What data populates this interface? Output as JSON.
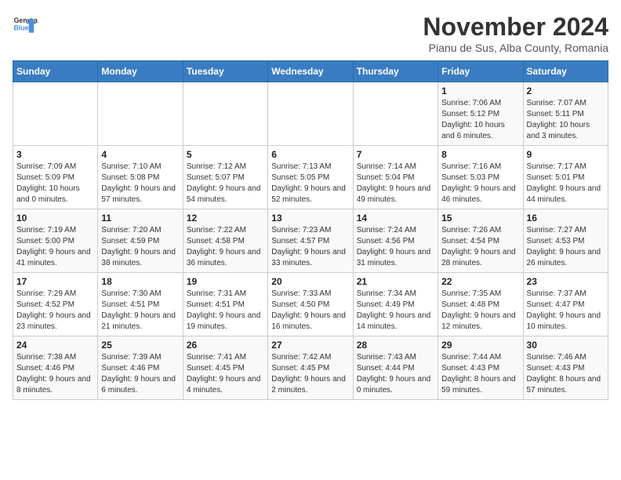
{
  "logo": {
    "general": "General",
    "blue": "Blue"
  },
  "title": "November 2024",
  "subtitle": "Pianu de Sus, Alba County, Romania",
  "days_of_week": [
    "Sunday",
    "Monday",
    "Tuesday",
    "Wednesday",
    "Thursday",
    "Friday",
    "Saturday"
  ],
  "weeks": [
    [
      {
        "day": "",
        "info": ""
      },
      {
        "day": "",
        "info": ""
      },
      {
        "day": "",
        "info": ""
      },
      {
        "day": "",
        "info": ""
      },
      {
        "day": "",
        "info": ""
      },
      {
        "day": "1",
        "info": "Sunrise: 7:06 AM\nSunset: 5:12 PM\nDaylight: 10 hours and 6 minutes."
      },
      {
        "day": "2",
        "info": "Sunrise: 7:07 AM\nSunset: 5:11 PM\nDaylight: 10 hours and 3 minutes."
      }
    ],
    [
      {
        "day": "3",
        "info": "Sunrise: 7:09 AM\nSunset: 5:09 PM\nDaylight: 10 hours and 0 minutes."
      },
      {
        "day": "4",
        "info": "Sunrise: 7:10 AM\nSunset: 5:08 PM\nDaylight: 9 hours and 57 minutes."
      },
      {
        "day": "5",
        "info": "Sunrise: 7:12 AM\nSunset: 5:07 PM\nDaylight: 9 hours and 54 minutes."
      },
      {
        "day": "6",
        "info": "Sunrise: 7:13 AM\nSunset: 5:05 PM\nDaylight: 9 hours and 52 minutes."
      },
      {
        "day": "7",
        "info": "Sunrise: 7:14 AM\nSunset: 5:04 PM\nDaylight: 9 hours and 49 minutes."
      },
      {
        "day": "8",
        "info": "Sunrise: 7:16 AM\nSunset: 5:03 PM\nDaylight: 9 hours and 46 minutes."
      },
      {
        "day": "9",
        "info": "Sunrise: 7:17 AM\nSunset: 5:01 PM\nDaylight: 9 hours and 44 minutes."
      }
    ],
    [
      {
        "day": "10",
        "info": "Sunrise: 7:19 AM\nSunset: 5:00 PM\nDaylight: 9 hours and 41 minutes."
      },
      {
        "day": "11",
        "info": "Sunrise: 7:20 AM\nSunset: 4:59 PM\nDaylight: 9 hours and 38 minutes."
      },
      {
        "day": "12",
        "info": "Sunrise: 7:22 AM\nSunset: 4:58 PM\nDaylight: 9 hours and 36 minutes."
      },
      {
        "day": "13",
        "info": "Sunrise: 7:23 AM\nSunset: 4:57 PM\nDaylight: 9 hours and 33 minutes."
      },
      {
        "day": "14",
        "info": "Sunrise: 7:24 AM\nSunset: 4:56 PM\nDaylight: 9 hours and 31 minutes."
      },
      {
        "day": "15",
        "info": "Sunrise: 7:26 AM\nSunset: 4:54 PM\nDaylight: 9 hours and 28 minutes."
      },
      {
        "day": "16",
        "info": "Sunrise: 7:27 AM\nSunset: 4:53 PM\nDaylight: 9 hours and 26 minutes."
      }
    ],
    [
      {
        "day": "17",
        "info": "Sunrise: 7:29 AM\nSunset: 4:52 PM\nDaylight: 9 hours and 23 minutes."
      },
      {
        "day": "18",
        "info": "Sunrise: 7:30 AM\nSunset: 4:51 PM\nDaylight: 9 hours and 21 minutes."
      },
      {
        "day": "19",
        "info": "Sunrise: 7:31 AM\nSunset: 4:51 PM\nDaylight: 9 hours and 19 minutes."
      },
      {
        "day": "20",
        "info": "Sunrise: 7:33 AM\nSunset: 4:50 PM\nDaylight: 9 hours and 16 minutes."
      },
      {
        "day": "21",
        "info": "Sunrise: 7:34 AM\nSunset: 4:49 PM\nDaylight: 9 hours and 14 minutes."
      },
      {
        "day": "22",
        "info": "Sunrise: 7:35 AM\nSunset: 4:48 PM\nDaylight: 9 hours and 12 minutes."
      },
      {
        "day": "23",
        "info": "Sunrise: 7:37 AM\nSunset: 4:47 PM\nDaylight: 9 hours and 10 minutes."
      }
    ],
    [
      {
        "day": "24",
        "info": "Sunrise: 7:38 AM\nSunset: 4:46 PM\nDaylight: 9 hours and 8 minutes."
      },
      {
        "day": "25",
        "info": "Sunrise: 7:39 AM\nSunset: 4:46 PM\nDaylight: 9 hours and 6 minutes."
      },
      {
        "day": "26",
        "info": "Sunrise: 7:41 AM\nSunset: 4:45 PM\nDaylight: 9 hours and 4 minutes."
      },
      {
        "day": "27",
        "info": "Sunrise: 7:42 AM\nSunset: 4:45 PM\nDaylight: 9 hours and 2 minutes."
      },
      {
        "day": "28",
        "info": "Sunrise: 7:43 AM\nSunset: 4:44 PM\nDaylight: 9 hours and 0 minutes."
      },
      {
        "day": "29",
        "info": "Sunrise: 7:44 AM\nSunset: 4:43 PM\nDaylight: 8 hours and 59 minutes."
      },
      {
        "day": "30",
        "info": "Sunrise: 7:46 AM\nSunset: 4:43 PM\nDaylight: 8 hours and 57 minutes."
      }
    ]
  ]
}
